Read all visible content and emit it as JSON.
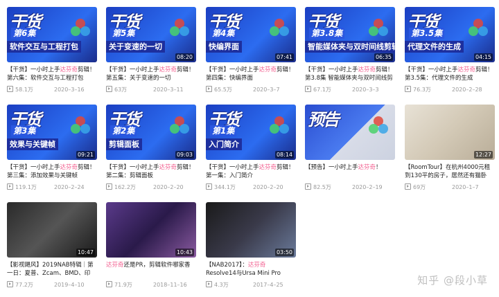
{
  "watermark": "知乎 @段小草",
  "videos": [
    {
      "thumb_big": "干货",
      "thumb_ep": "第6集",
      "thumb_bar": "软件交互与工程打包",
      "duration": "",
      "t1": "【干货】一小时上手",
      "hl": "达芬奇",
      "t2": "剪辑！第六集：软件交互与工程打包",
      "views": "58.1万",
      "date": "2020–3–16"
    },
    {
      "thumb_big": "干货",
      "thumb_ep": "第5集",
      "thumb_bar": "关于变速的一切",
      "duration": "08:20",
      "t1": "【干货】一小时上手",
      "hl": "达芬奇",
      "t2": "剪辑！第五集：关于变速的一切",
      "views": "63万",
      "date": "2020–3–11"
    },
    {
      "thumb_big": "干货",
      "thumb_ep": "第4集",
      "thumb_bar": "快编界面",
      "duration": "07:41",
      "t1": "【干货】一小时上手",
      "hl": "达芬奇",
      "t2": "剪辑！第四集：快编界面",
      "views": "65.5万",
      "date": "2020–3–7"
    },
    {
      "thumb_big": "干货",
      "thumb_ep": "第3.8集",
      "thumb_bar": "智能媒体夹与双时间线剪辑",
      "duration": "06:35",
      "t1": "【干货】一小时上手",
      "hl": "达芬奇",
      "t2": "剪辑！第3.8集 智能媒体夹与双时间线剪辑",
      "views": "67.1万",
      "date": "2020–3–3"
    },
    {
      "thumb_big": "干货",
      "thumb_ep": "第3.5集",
      "thumb_bar": "代理文件的生成",
      "duration": "04:15",
      "t1": "【干货】一小时上手",
      "hl": "达芬奇",
      "t2": "剪辑！第3.5集：代理文件的生成",
      "views": "76.3万",
      "date": "2020–2–28"
    },
    {
      "thumb_big": "干货",
      "thumb_ep": "第3集",
      "thumb_bar": "效果与关键帧",
      "duration": "09:21",
      "t1": "【干货】一小时上手",
      "hl": "达芬奇",
      "t2": "剪辑！第三集：添加效果与关键帧",
      "views": "119.1万",
      "date": "2020–2–24"
    },
    {
      "thumb_big": "干货",
      "thumb_ep": "第2集",
      "thumb_bar": "剪辑面板",
      "duration": "09:03",
      "t1": "【干货】一小时上手",
      "hl": "达芬奇",
      "t2": "剪辑！第二集：剪辑面板",
      "views": "162.2万",
      "date": "2020–2–20"
    },
    {
      "thumb_big": "干货",
      "thumb_ep": "第1集",
      "thumb_bar": "入门简介",
      "duration": "08:14",
      "t1": "【干货】一小时上手",
      "hl": "达芬奇",
      "t2": "剪辑！第一集：入门简介",
      "views": "344.1万",
      "date": "2020–2–20"
    },
    {
      "thumb_big": "预告",
      "thumb_ep": "",
      "thumb_bar": "",
      "duration": "",
      "t1": "【预告】一小时上手",
      "hl": "达芬奇",
      "t2": "！",
      "views": "82.5万",
      "date": "2020–2–19"
    },
    {
      "thumb_big": "",
      "thumb_ep": "",
      "thumb_bar": "",
      "duration": "12:27",
      "t1": "【RoomTour】在杭州4000元租到130平的房子，居然还有猫卧室?",
      "hl": "",
      "t2": "",
      "views": "69万",
      "date": "2020–1–7"
    },
    {
      "thumb_big": "",
      "thumb_ep": "",
      "thumb_bar": "",
      "duration": "10:47",
      "t1": "【影视飓风】2019NAB特辑｜第一日：夏普、Zcam、BMD、印迹、",
      "hl": "",
      "t2": "",
      "views": "77.2万",
      "date": "2019–4–10"
    },
    {
      "thumb_big": "",
      "thumb_ep": "",
      "thumb_bar": "",
      "duration": "10:43",
      "t1": "",
      "hl": "达芬奇",
      "t2": "还是PR，剪辑软件哪家香",
      "views": "71.9万",
      "date": "2018–11–16"
    },
    {
      "thumb_big": "",
      "thumb_ep": "",
      "thumb_bar": "",
      "duration": "03:50",
      "t1": "【NAB2017】：",
      "hl": "达芬奇",
      "t2": "Resolve14与Ursa Mini Pro",
      "views": "4.3万",
      "date": "2017–4–25"
    }
  ],
  "colors": {
    "accent": "#f25d8e",
    "thumb_blue": "#1a44c8",
    "bar_blue": "#1d2f9e"
  }
}
